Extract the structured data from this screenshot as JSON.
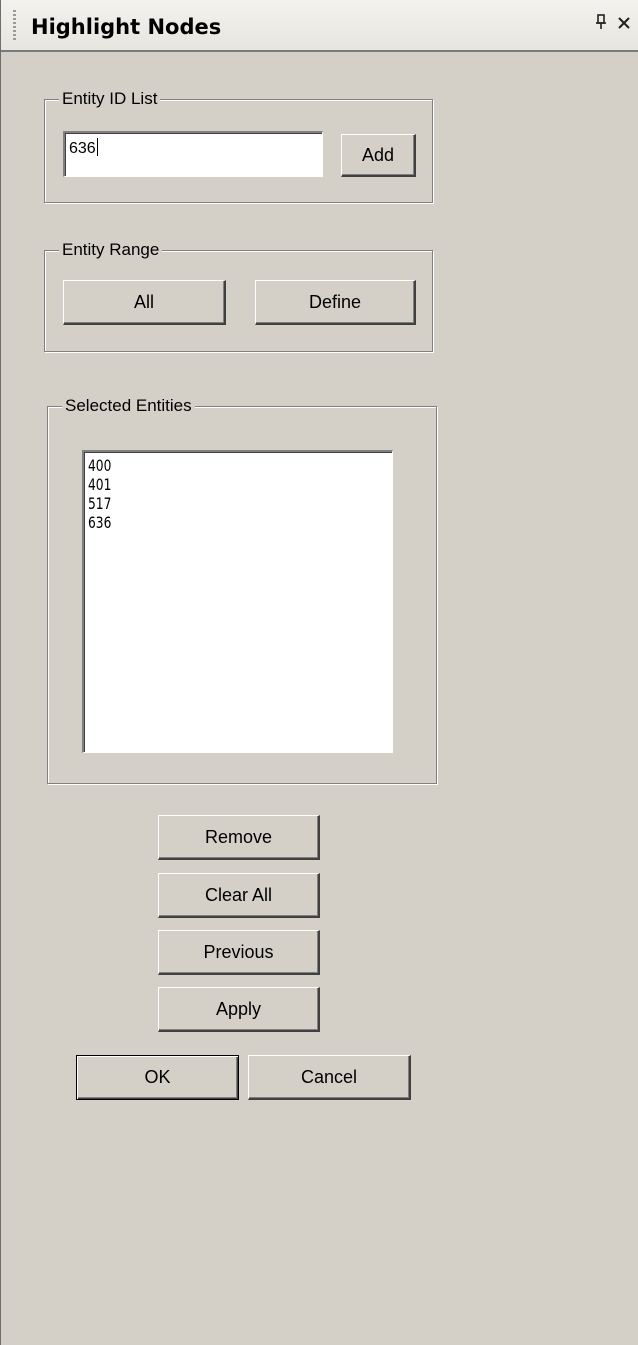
{
  "panel": {
    "title": "Highlight Nodes",
    "pin_glyph": "⭰",
    "close_glyph": "✕"
  },
  "entity_id_list": {
    "legend": "Entity ID List",
    "input_value": "636",
    "add_label": "Add"
  },
  "entity_range": {
    "legend": "Entity Range",
    "all_label": "All",
    "define_label": "Define"
  },
  "selected_entities": {
    "legend": "Selected Entities",
    "items": [
      "400",
      "401",
      "517",
      "636"
    ]
  },
  "actions": {
    "remove_label": "Remove",
    "clear_all_label": "Clear All",
    "previous_label": "Previous",
    "apply_label": "Apply",
    "ok_label": "OK",
    "cancel_label": "Cancel"
  }
}
